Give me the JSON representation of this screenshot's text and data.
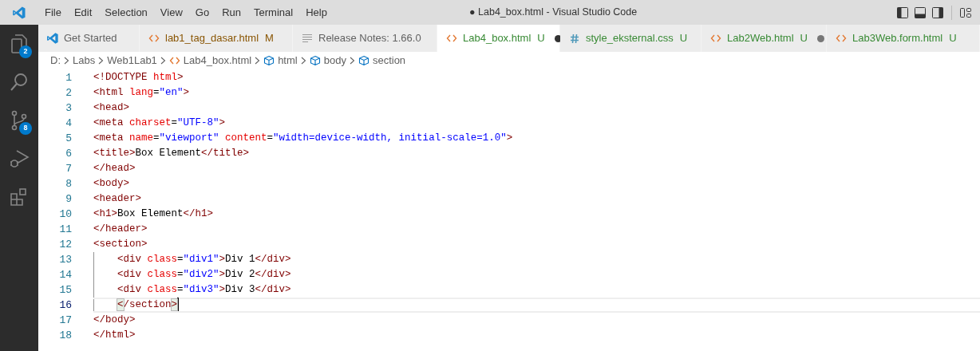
{
  "title_bar": {
    "menus": [
      "File",
      "Edit",
      "Selection",
      "View",
      "Go",
      "Run",
      "Terminal",
      "Help"
    ],
    "title": "● Lab4_box.html - Visual Studio Code"
  },
  "activity_bar": [
    {
      "kind": "files",
      "badge": "2"
    },
    {
      "kind": "search"
    },
    {
      "kind": "source-control",
      "badge": "8"
    },
    {
      "kind": "run-debug"
    },
    {
      "kind": "extensions"
    }
  ],
  "tabs": [
    {
      "kind": "vscode",
      "label": "Get Started",
      "selected": false,
      "dirty": false
    },
    {
      "kind": "html",
      "label": "lab1_tag_dasar.html",
      "modified": true,
      "status": "M",
      "selected": false,
      "dirty": false
    },
    {
      "kind": "lines",
      "label": "Release Notes: 1.66.0",
      "selected": false,
      "dirty": false
    },
    {
      "kind": "html",
      "label": "Lab4_box.html",
      "modified": false,
      "status": "U",
      "selected": true,
      "dirty": true
    },
    {
      "kind": "css",
      "label": "style_eksternal.css",
      "modified": false,
      "status": "U",
      "selected": false,
      "dirty": false
    },
    {
      "kind": "html",
      "label": "Lab2Web.html",
      "modified": false,
      "status": "U",
      "selected": false,
      "dirty": true
    },
    {
      "kind": "html",
      "label": "Lab3Web.form.html",
      "modified": false,
      "status": "U",
      "selected": false,
      "dirty": false
    }
  ],
  "breadcrumb": [
    {
      "kind": "folder",
      "label": "D:"
    },
    {
      "kind": "folder",
      "label": "Labs"
    },
    {
      "kind": "folder",
      "label": "Web1Lab1"
    },
    {
      "kind": "html",
      "label": "Lab4_box.html"
    },
    {
      "kind": "symbol",
      "label": "html"
    },
    {
      "kind": "symbol",
      "label": "body"
    },
    {
      "kind": "symbol",
      "label": "section"
    }
  ],
  "editor": {
    "lines": [
      {
        "number": "1",
        "current": false,
        "tokens": [
          {
            "kind": "tag",
            "text": "<!DOCTYPE "
          },
          {
            "kind": "attr",
            "text": "html"
          },
          {
            "kind": "tag",
            "text": ">"
          }
        ]
      },
      {
        "number": "2",
        "current": false,
        "tokens": [
          {
            "kind": "tag",
            "text": "<html "
          },
          {
            "kind": "attr",
            "text": "lang"
          },
          {
            "kind": "text",
            "text": "="
          },
          {
            "kind": "value",
            "text": "\"en\""
          },
          {
            "kind": "tag",
            "text": ">"
          }
        ]
      },
      {
        "number": "3",
        "current": false,
        "tokens": [
          {
            "kind": "tag",
            "text": "<head>"
          }
        ]
      },
      {
        "number": "4",
        "current": false,
        "tokens": [
          {
            "kind": "tag",
            "text": "<meta "
          },
          {
            "kind": "attr",
            "text": "charset"
          },
          {
            "kind": "text",
            "text": "="
          },
          {
            "kind": "value",
            "text": "\"UTF-8\""
          },
          {
            "kind": "tag",
            "text": ">"
          }
        ]
      },
      {
        "number": "5",
        "current": false,
        "tokens": [
          {
            "kind": "tag",
            "text": "<meta "
          },
          {
            "kind": "attr",
            "text": "name"
          },
          {
            "kind": "text",
            "text": "="
          },
          {
            "kind": "value",
            "text": "\"viewport\" "
          },
          {
            "kind": "attr",
            "text": "content"
          },
          {
            "kind": "text",
            "text": "="
          },
          {
            "kind": "value",
            "text": "\"width=device-width, initial-scale=1.0\""
          },
          {
            "kind": "tag",
            "text": ">"
          }
        ]
      },
      {
        "number": "6",
        "current": false,
        "tokens": [
          {
            "kind": "tag",
            "text": "<title>"
          },
          {
            "kind": "text",
            "text": "Box Element"
          },
          {
            "kind": "tag",
            "text": "</title>"
          }
        ]
      },
      {
        "number": "7",
        "current": false,
        "tokens": [
          {
            "kind": "tag",
            "text": "</head>"
          }
        ]
      },
      {
        "number": "8",
        "current": false,
        "tokens": [
          {
            "kind": "tag",
            "text": "<body>"
          }
        ]
      },
      {
        "number": "9",
        "current": false,
        "tokens": [
          {
            "kind": "tag",
            "text": "<header>"
          }
        ]
      },
      {
        "number": "10",
        "current": false,
        "tokens": [
          {
            "kind": "tag",
            "text": "<h1>"
          },
          {
            "kind": "text",
            "text": "Box Element"
          },
          {
            "kind": "tag",
            "text": "</h1>"
          }
        ]
      },
      {
        "number": "11",
        "current": false,
        "tokens": [
          {
            "kind": "tag",
            "text": "</header>"
          }
        ]
      },
      {
        "number": "12",
        "current": false,
        "tokens": [
          {
            "kind": "tag",
            "text": "<section>"
          }
        ]
      },
      {
        "number": "13",
        "current": false,
        "indented": true,
        "tokens": [
          {
            "kind": "tag",
            "text": "<div "
          },
          {
            "kind": "attr",
            "text": "class"
          },
          {
            "kind": "text",
            "text": "="
          },
          {
            "kind": "value",
            "text": "\"div1\""
          },
          {
            "kind": "tag",
            "text": ">"
          },
          {
            "kind": "text",
            "text": "Div 1"
          },
          {
            "kind": "tag",
            "text": "</div>"
          }
        ]
      },
      {
        "number": "14",
        "current": false,
        "indented": true,
        "tokens": [
          {
            "kind": "tag",
            "text": "<div "
          },
          {
            "kind": "attr",
            "text": "class"
          },
          {
            "kind": "text",
            "text": "="
          },
          {
            "kind": "value",
            "text": "\"div2\""
          },
          {
            "kind": "tag",
            "text": ">"
          },
          {
            "kind": "text",
            "text": "Div 2"
          },
          {
            "kind": "tag",
            "text": "</div>"
          }
        ]
      },
      {
        "number": "15",
        "current": false,
        "indented": true,
        "tokens": [
          {
            "kind": "tag",
            "text": "<div "
          },
          {
            "kind": "attr",
            "text": "class"
          },
          {
            "kind": "text",
            "text": "="
          },
          {
            "kind": "value",
            "text": "\"div3\""
          },
          {
            "kind": "tag",
            "text": ">"
          },
          {
            "kind": "text",
            "text": "Div 3"
          },
          {
            "kind": "tag",
            "text": "</div>"
          }
        ]
      },
      {
        "number": "16",
        "current": true,
        "indented": true,
        "tokens": [
          {
            "kind": "match",
            "text": "<"
          },
          {
            "kind": "tag",
            "text": "/section"
          },
          {
            "kind": "match",
            "text": ">"
          }
        ]
      },
      {
        "number": "17",
        "current": false,
        "tokens": [
          {
            "kind": "tag",
            "text": "</body>"
          }
        ]
      },
      {
        "number": "18",
        "current": false,
        "tokens": [
          {
            "kind": "tag",
            "text": "</html>"
          }
        ]
      }
    ]
  }
}
